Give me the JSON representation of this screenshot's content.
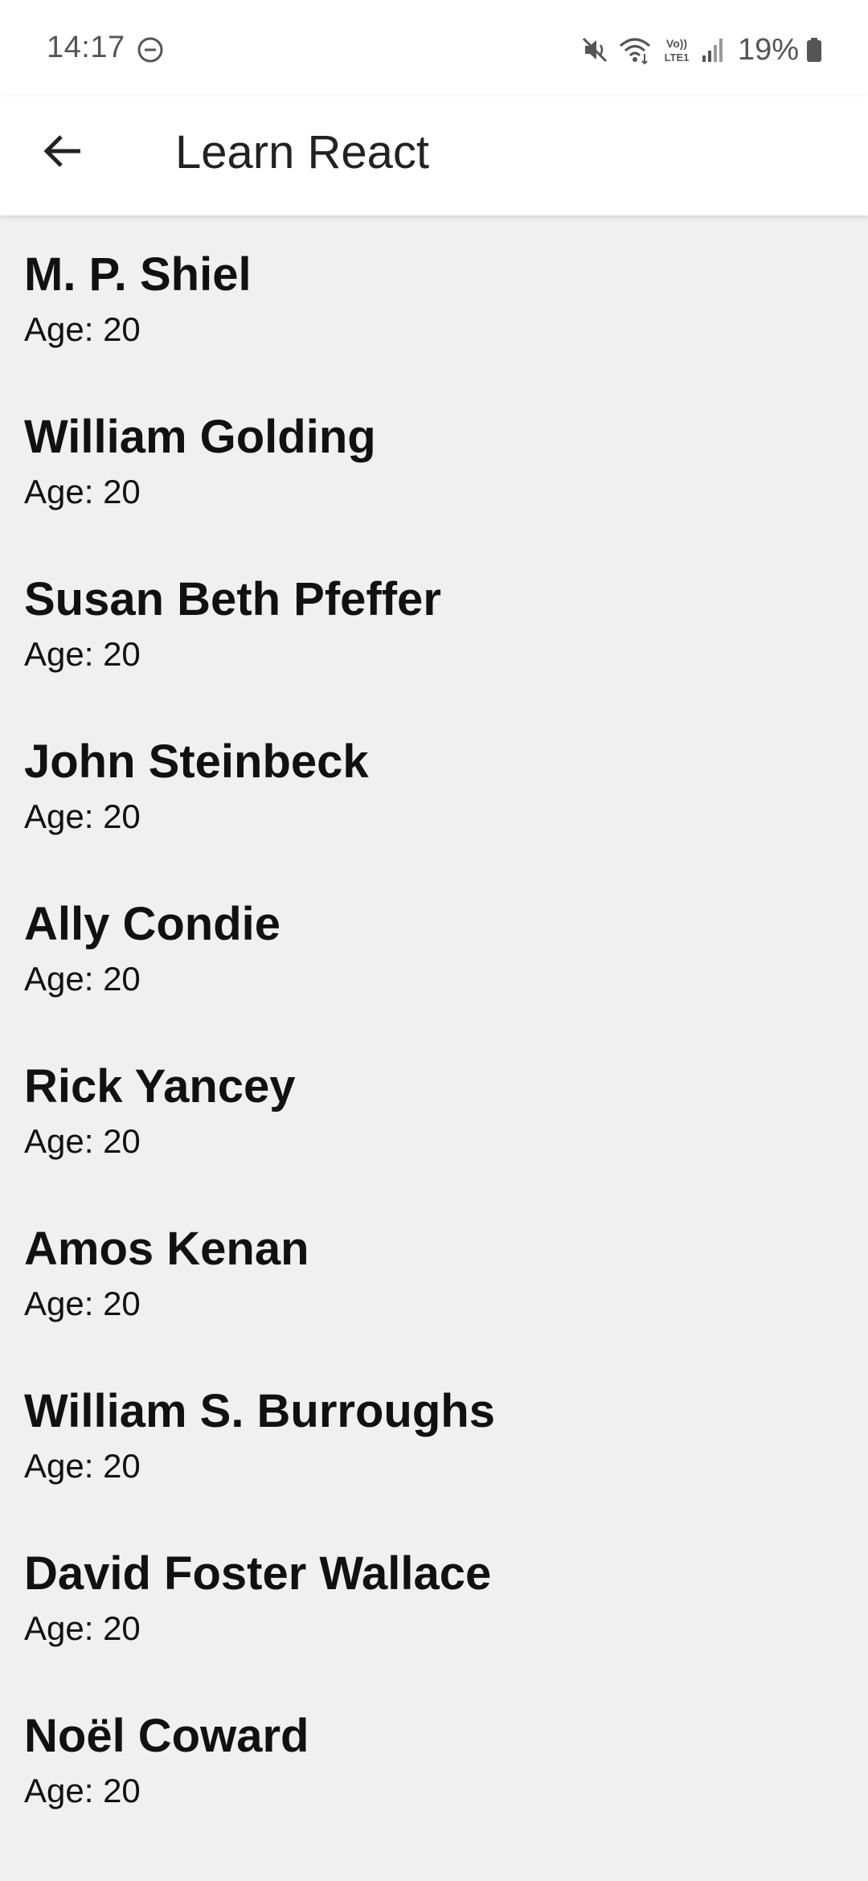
{
  "status_bar": {
    "time": "14:17",
    "battery": "19%",
    "icons": [
      "do-not-disturb-icon",
      "mute-icon",
      "wifi-icon",
      "volte-icon",
      "signal-icon",
      "battery-icon"
    ],
    "network_label": "Vo)) LTE1"
  },
  "app_bar": {
    "title": "Learn React",
    "back_icon": "arrow-left-icon"
  },
  "list": {
    "items": [
      {
        "name": "M. P. Shiel",
        "age": "Age: 20"
      },
      {
        "name": "William Golding",
        "age": "Age: 20"
      },
      {
        "name": "Susan Beth Pfeffer",
        "age": "Age: 20"
      },
      {
        "name": "John Steinbeck",
        "age": "Age: 20"
      },
      {
        "name": "Ally Condie",
        "age": "Age: 20"
      },
      {
        "name": "Rick Yancey",
        "age": "Age: 20"
      },
      {
        "name": "Amos Kenan",
        "age": "Age: 20"
      },
      {
        "name": "William S. Burroughs",
        "age": "Age: 20"
      },
      {
        "name": "David Foster Wallace",
        "age": "Age: 20"
      },
      {
        "name": "Noël Coward",
        "age": "Age: 20"
      }
    ]
  },
  "colors": {
    "background": "#f0f0f0",
    "app_bar": "#ffffff",
    "text": "#111111",
    "status_text": "#555555"
  }
}
